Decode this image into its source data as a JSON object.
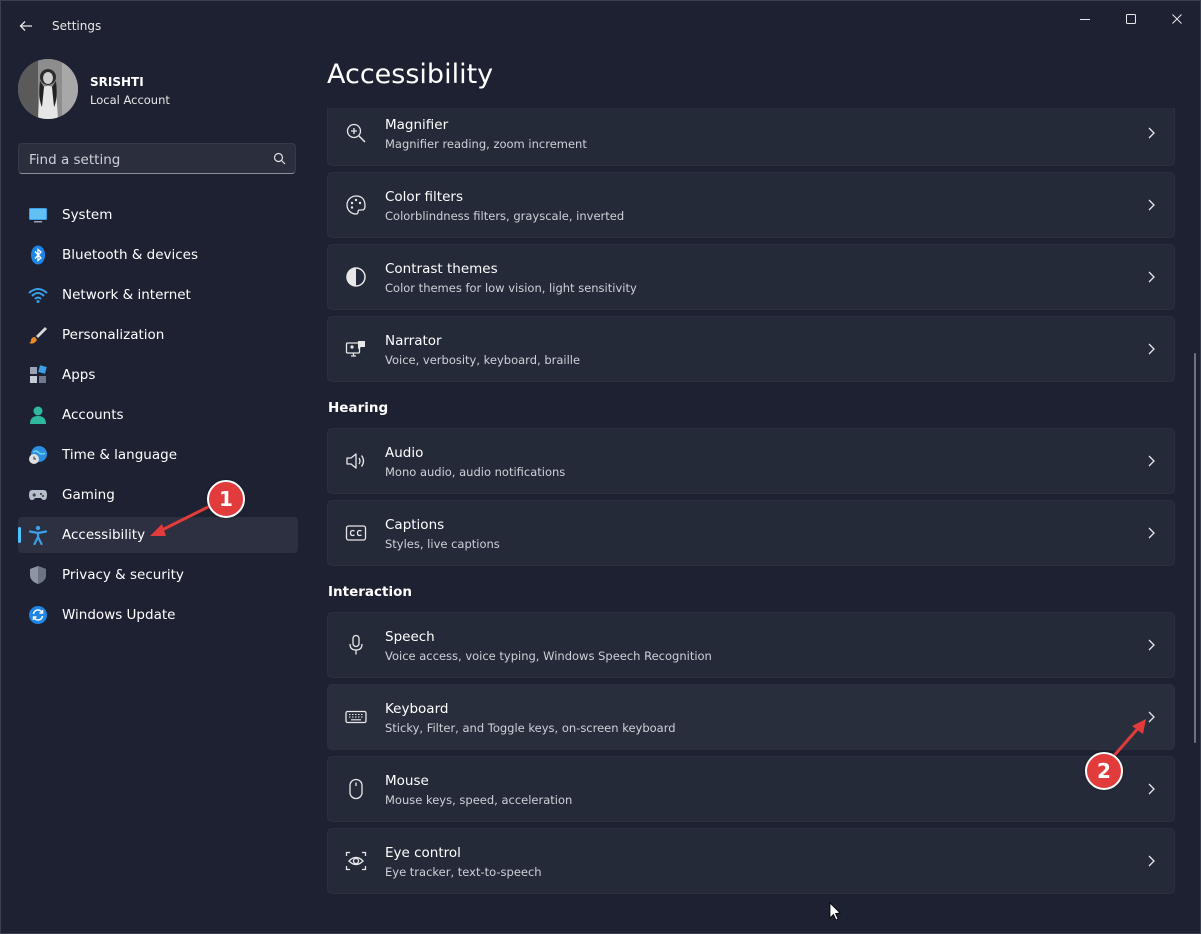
{
  "window": {
    "title": "Settings",
    "back_icon": "back-arrow-icon",
    "controls": [
      "minimize-icon",
      "maximize-icon",
      "close-icon"
    ]
  },
  "profile": {
    "name": "SRISHTI",
    "account_type": "Local Account"
  },
  "search": {
    "placeholder": "Find a setting",
    "icon": "search-icon"
  },
  "nav": {
    "items": [
      {
        "label": "System",
        "icon": "system-icon",
        "active": false
      },
      {
        "label": "Bluetooth & devices",
        "icon": "bluetooth-icon",
        "active": false
      },
      {
        "label": "Network & internet",
        "icon": "wifi-icon",
        "active": false
      },
      {
        "label": "Personalization",
        "icon": "brush-icon",
        "active": false
      },
      {
        "label": "Apps",
        "icon": "apps-icon",
        "active": false
      },
      {
        "label": "Accounts",
        "icon": "person-icon",
        "active": false
      },
      {
        "label": "Time & language",
        "icon": "globe-clock-icon",
        "active": false
      },
      {
        "label": "Gaming",
        "icon": "gamepad-icon",
        "active": false
      },
      {
        "label": "Accessibility",
        "icon": "accessibility-icon",
        "active": true
      },
      {
        "label": "Privacy & security",
        "icon": "shield-icon",
        "active": false
      },
      {
        "label": "Windows Update",
        "icon": "update-icon",
        "active": false
      }
    ]
  },
  "main": {
    "title": "Accessibility",
    "vision_cards": [
      {
        "title": "Magnifier",
        "subtitle": "Magnifier reading, zoom increment",
        "icon": "magnifier-icon"
      },
      {
        "title": "Color filters",
        "subtitle": "Colorblindness filters, grayscale, inverted",
        "icon": "palette-icon"
      },
      {
        "title": "Contrast themes",
        "subtitle": "Color themes for low vision, light sensitivity",
        "icon": "contrast-icon"
      },
      {
        "title": "Narrator",
        "subtitle": "Voice, verbosity, keyboard, braille",
        "icon": "narrator-icon"
      }
    ],
    "hearing_header": "Hearing",
    "hearing_cards": [
      {
        "title": "Audio",
        "subtitle": "Mono audio, audio notifications",
        "icon": "speaker-icon"
      },
      {
        "title": "Captions",
        "subtitle": "Styles, live captions",
        "icon": "captions-icon"
      }
    ],
    "interaction_header": "Interaction",
    "interaction_cards": [
      {
        "title": "Speech",
        "subtitle": "Voice access, voice typing, Windows Speech Recognition",
        "icon": "microphone-icon"
      },
      {
        "title": "Keyboard",
        "subtitle": "Sticky, Filter, and Toggle keys, on-screen keyboard",
        "icon": "keyboard-icon"
      },
      {
        "title": "Mouse",
        "subtitle": "Mouse keys, speed, acceleration",
        "icon": "mouse-icon"
      },
      {
        "title": "Eye control",
        "subtitle": "Eye tracker, text-to-speech",
        "icon": "eye-icon"
      }
    ]
  },
  "annotations": [
    {
      "number": "1",
      "color": "#e23b3b"
    },
    {
      "number": "2",
      "color": "#e23b3b"
    }
  ],
  "colors": {
    "accent": "#4cc2ff",
    "background": "#1d2131",
    "card": "#252a39"
  }
}
